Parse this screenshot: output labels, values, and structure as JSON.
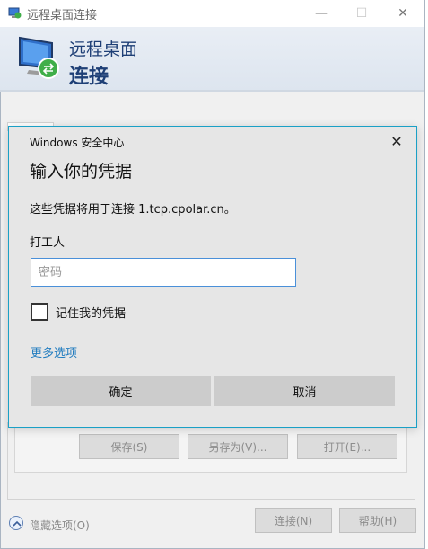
{
  "window": {
    "title": "远程桌面连接",
    "controls": {
      "minimize": "—",
      "maximize": "☐",
      "close": "✕"
    }
  },
  "header": {
    "line1": "远程桌面",
    "line2": "连接"
  },
  "background_panel": {
    "save_label": "保存(S)",
    "save_as_label": "另存为(V)...",
    "open_label": "打开(E)..."
  },
  "footer": {
    "options_label": "隐藏选项(O)",
    "connect_label": "连接(N)",
    "help_label": "帮助(H)"
  },
  "security_dialog": {
    "title": "Windows 安全中心",
    "close_glyph": "✕",
    "heading": "输入你的凭据",
    "description": "这些凭据将用于连接 1.tcp.cpolar.cn。",
    "username": "打工人",
    "password_value": "",
    "password_placeholder": "密码",
    "remember_label": "记住我的凭据",
    "remember_checked": false,
    "more_options_label": "更多选项",
    "ok_label": "确定",
    "cancel_label": "取消"
  },
  "colors": {
    "accent_link": "#1f7bbf",
    "dialog_border": "#1aa0c6",
    "header_text": "#1e3f76",
    "input_focus_border": "#4a90d9"
  }
}
